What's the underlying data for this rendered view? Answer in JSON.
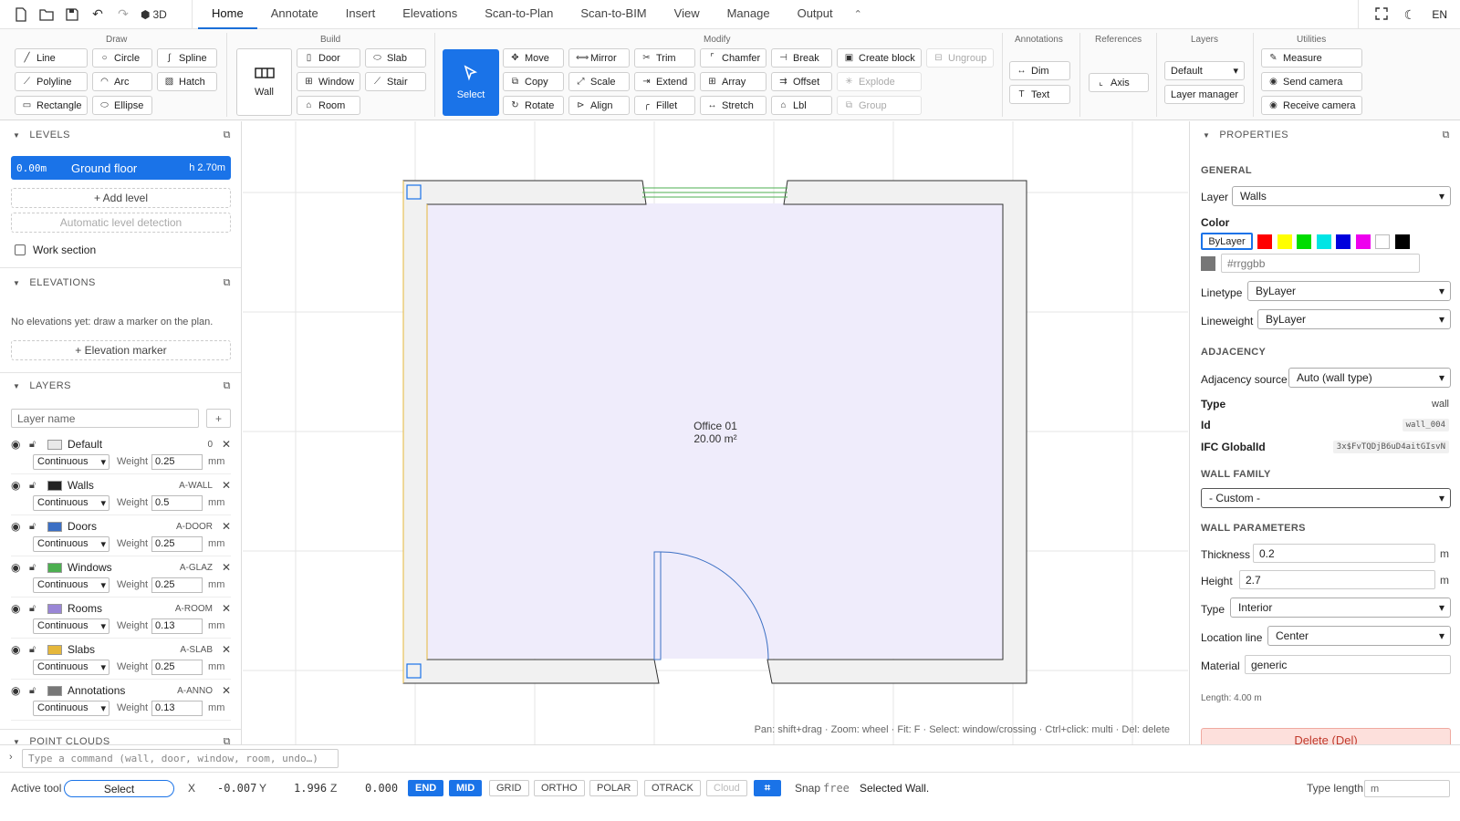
{
  "app": {
    "quick_access": {
      "three_d_label": "3D"
    },
    "tabs": [
      "Home",
      "Annotate",
      "Insert",
      "Elevations",
      "Scan-to-Plan",
      "Scan-to-BIM",
      "View",
      "Manage",
      "Output"
    ],
    "active_tab": "Home",
    "language": "EN"
  },
  "ribbon": {
    "draw": {
      "title": "Draw",
      "buttons": [
        "Line",
        "Circle",
        "Spline",
        "Polyline",
        "Arc",
        "Hatch",
        "Rectangle",
        "Ellipse"
      ]
    },
    "build": {
      "title": "Build",
      "big_button": "Wall",
      "buttons": [
        "Door",
        "Slab",
        "Window",
        "Stair",
        "Room"
      ]
    },
    "select_label": "Select",
    "modify": {
      "title": "Modify",
      "buttons": [
        "Move",
        "Mirror",
        "Trim",
        "Chamfer",
        "Break",
        "Create block",
        "Ungroup",
        "Copy",
        "Scale",
        "Extend",
        "Array",
        "Offset",
        "Explode",
        "Rotate",
        "Align",
        "Fillet",
        "Stretch",
        "Lbl",
        "Group"
      ]
    },
    "annotations": {
      "title": "Annotations",
      "buttons": [
        "Dim",
        "Text"
      ]
    },
    "references": {
      "title": "References",
      "buttons": [
        "Axis"
      ]
    },
    "layers": {
      "title": "Layers",
      "selected": "Default",
      "manager": "Layer manager"
    },
    "utilities": {
      "title": "Utilities",
      "buttons": [
        "Measure",
        "Send camera",
        "Receive camera"
      ]
    }
  },
  "left": {
    "levels": {
      "title": "LEVELS",
      "elevation": "0.00m",
      "name": "Ground floor",
      "height": "h 2.70m",
      "add": "+ Add level",
      "auto": "Automatic level detection",
      "work_section": "Work section"
    },
    "elevations": {
      "title": "ELEVATIONS",
      "empty": "No elevations yet: draw a marker on the plan.",
      "add": "+ Elevation marker"
    },
    "layers": {
      "title": "LAYERS",
      "placeholder": "Layer name",
      "add": "+",
      "weight_label": "Weight",
      "unit": "mm",
      "items": [
        {
          "name": "Default",
          "code": "0",
          "linetype": "Continuous",
          "weight": "0.25",
          "color": "#e8e8e8"
        },
        {
          "name": "Walls",
          "code": "A-WALL",
          "linetype": "Continuous",
          "weight": "0.5",
          "color": "#222222"
        },
        {
          "name": "Doors",
          "code": "A-DOOR",
          "linetype": "Continuous",
          "weight": "0.25",
          "color": "#3b6fc4"
        },
        {
          "name": "Windows",
          "code": "A-GLAZ",
          "linetype": "Continuous",
          "weight": "0.25",
          "color": "#4caf50"
        },
        {
          "name": "Rooms",
          "code": "A-ROOM",
          "linetype": "Continuous",
          "weight": "0.13",
          "color": "#9a86d6"
        },
        {
          "name": "Slabs",
          "code": "A-SLAB",
          "linetype": "Continuous",
          "weight": "0.25",
          "color": "#e5b73b"
        },
        {
          "name": "Annotations",
          "code": "A-ANNO",
          "linetype": "Continuous",
          "weight": "0.13",
          "color": "#777777"
        }
      ]
    },
    "point_clouds": {
      "title": "POINT CLOUDS"
    }
  },
  "canvas": {
    "room_name": "Office 01",
    "room_area": "20.00 m²",
    "hint": "Pan: shift+drag · Zoom: wheel · Fit: F · Select: window/crossing · Ctrl+click: multi · Del: delete"
  },
  "properties": {
    "title": "PROPERTIES",
    "general": "GENERAL",
    "layer_label": "Layer",
    "layer_value": "Walls",
    "color_label": "Color",
    "color_bylayer": "ByLayer",
    "color_swatches": [
      "#ff0000",
      "#ffff00",
      "#00dd00",
      "#00e5e5",
      "#0000dd",
      "#ee00ee",
      "#ffffff",
      "#000000"
    ],
    "hex_placeholder": "#rrggbb",
    "linetype_label": "Linetype",
    "linetype_value": "ByLayer",
    "lineweight_label": "Lineweight",
    "lineweight_value": "ByLayer",
    "adjacency": "ADJACENCY",
    "adjacency_source_label": "Adjacency source",
    "adjacency_source_value": "Auto (wall type)",
    "type_label": "Type",
    "type_value": "wall",
    "id_label": "Id",
    "id_value": "wall_004",
    "ifc_label": "IFC GlobalId",
    "ifc_value": "3x$FvTQDjB6uD4aitGIsvN",
    "wall_family": "WALL FAMILY",
    "family_value": "- Custom -",
    "wall_params": "WALL PARAMETERS",
    "thickness_label": "Thickness",
    "thickness_value": "0.2",
    "height_label": "Height",
    "height_value": "2.7",
    "unit_m": "m",
    "wtype_label": "Type",
    "wtype_value": "Interior",
    "location_label": "Location line",
    "location_value": "Center",
    "material_label": "Material",
    "material_value": "generic",
    "length": "Length: 4.00 m",
    "delete": "Delete (Del)"
  },
  "command": {
    "placeholder": "Type a command (wall, door, window, room, undo…)"
  },
  "status": {
    "active_tool_label": "Active tool",
    "active_tool": "Select",
    "x_label": "X",
    "x": "-0.007",
    "y_label": "Y",
    "y": "1.996",
    "z_label": "Z",
    "z": "0.000",
    "toggles": [
      "END",
      "MID",
      "GRID",
      "ORTHO",
      "POLAR",
      "OTRACK",
      "Cloud"
    ],
    "snap_label": "Snap",
    "snap_value": "free",
    "message": "Selected Wall.",
    "type_length_label": "Type length",
    "type_length_placeholder": "m"
  },
  "colors": {
    "accent": "#1a73e8",
    "room_fill": "#efecfb",
    "wall_fill": "#f1f1f1",
    "door": "#3b6fc4",
    "window": "#4caf50",
    "selection": "#e5b73b"
  }
}
